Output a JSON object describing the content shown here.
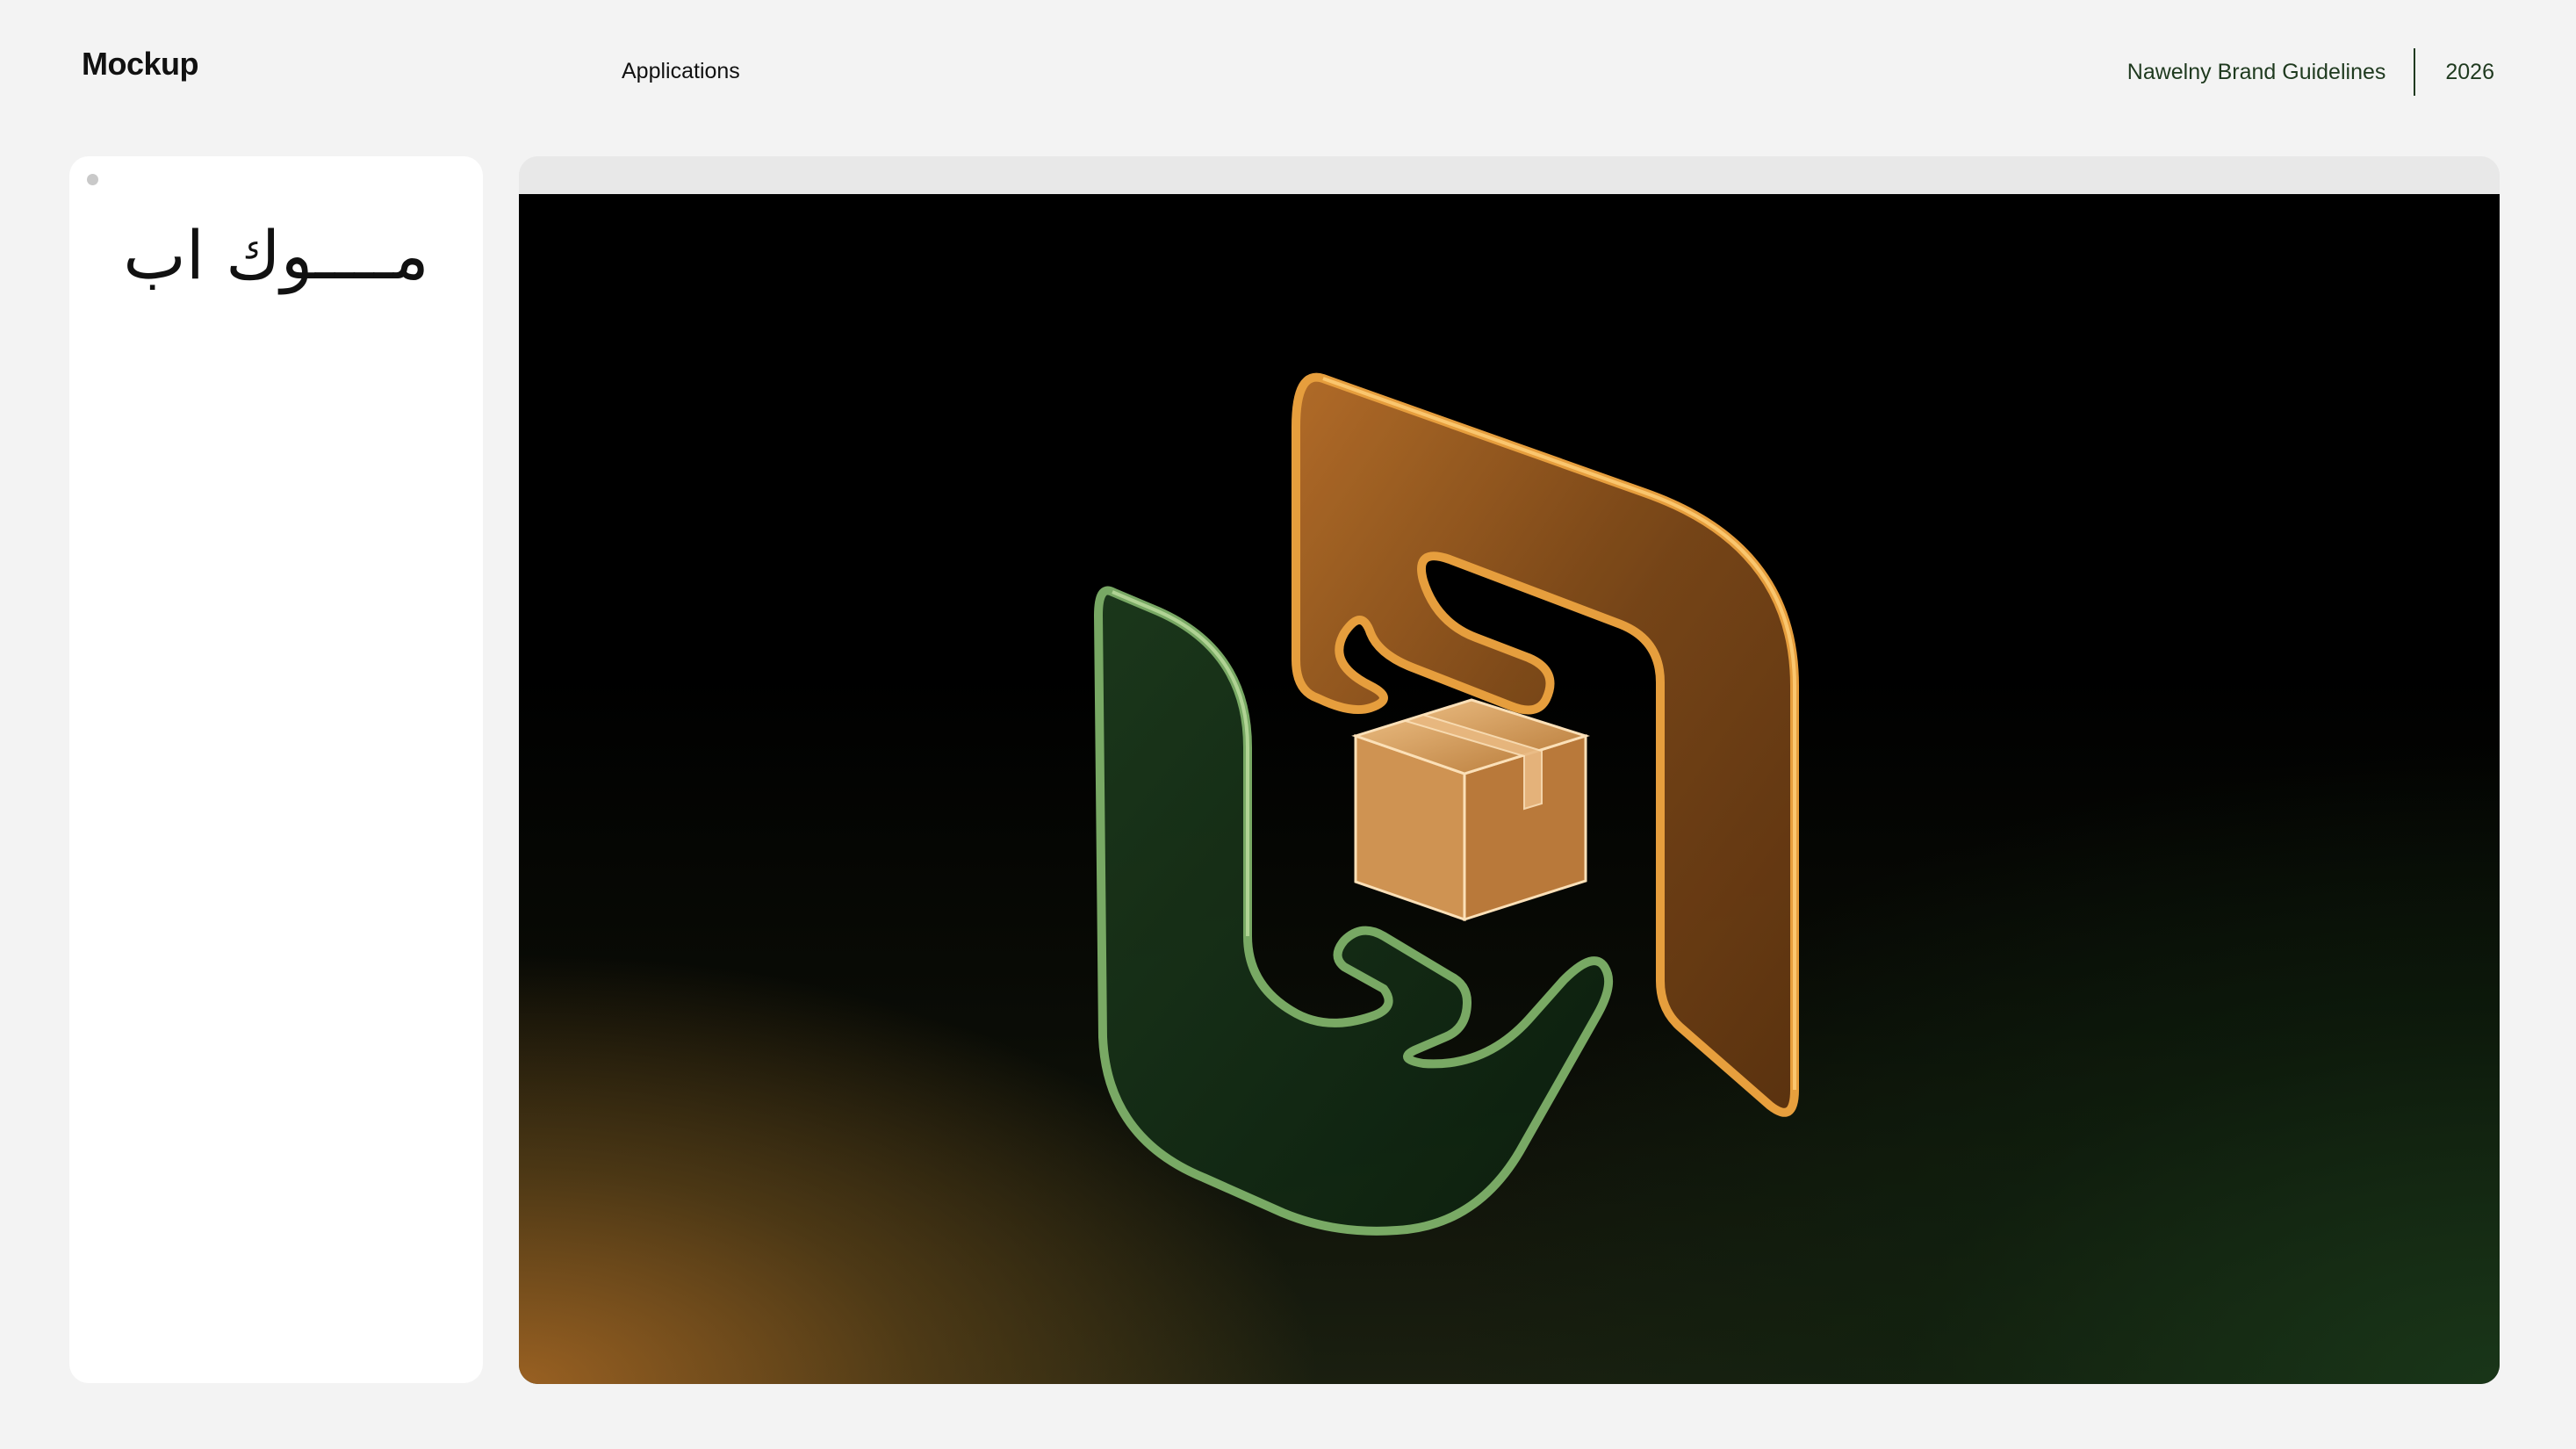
{
  "header": {
    "title": "Mockup",
    "section": "Applications",
    "brand": "Nawelny Brand Guidelines",
    "year": "2026"
  },
  "sidebar": {
    "heading": "مــــوك اب"
  },
  "colors": {
    "background": "#f3f3f3",
    "brand_green": "#1f3a1f",
    "glass_orange": "#c87a2a",
    "glass_green": "#3e6e36",
    "box": "#e0ae72"
  },
  "icons": {
    "logo": "nawelny-3d-glass-logo",
    "package": "package-box-icon"
  }
}
